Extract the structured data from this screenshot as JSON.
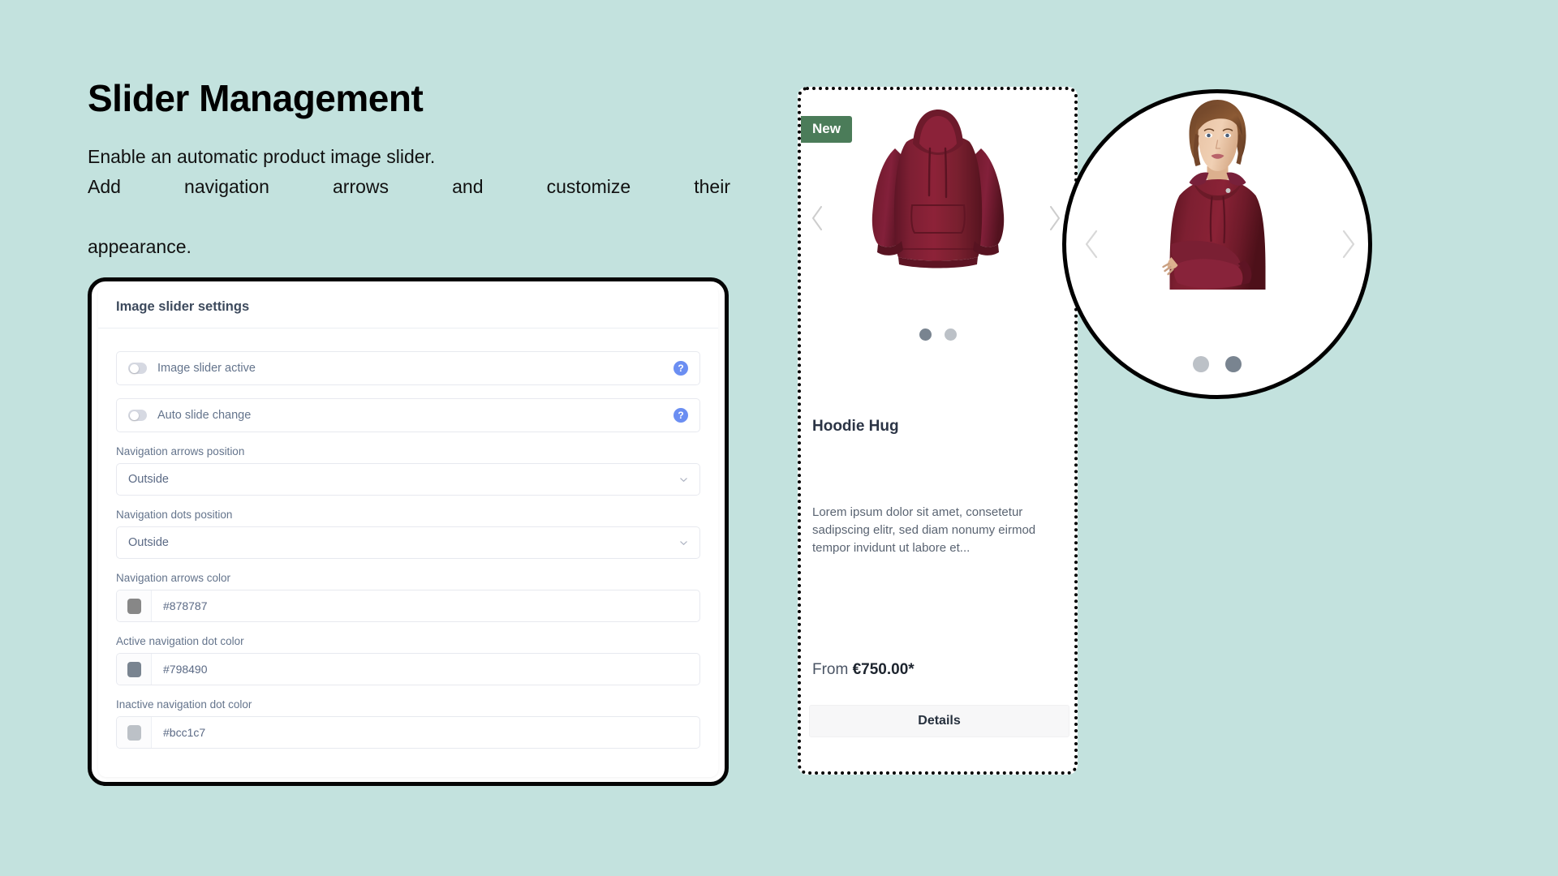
{
  "background_color": "#c3e2de",
  "heading": {
    "title": "Slider Management",
    "description_line1": "Enable an automatic product image slider.",
    "description_line2": "Add navigation arrows and customize their",
    "description_line3": "appearance."
  },
  "settings_card": {
    "header_title": "Image slider settings",
    "toggles": [
      {
        "label": "Image slider active",
        "state": "off",
        "help_icon": "help-icon",
        "help_glyph": "?"
      },
      {
        "label": "Auto slide change",
        "state": "off",
        "help_icon": "help-icon",
        "help_glyph": "?"
      }
    ],
    "selects": [
      {
        "label": "Navigation arrows position",
        "value": "Outside",
        "icon": "chevron-down-icon"
      },
      {
        "label": "Navigation dots position",
        "value": "Outside",
        "icon": "chevron-down-icon"
      }
    ],
    "colors": [
      {
        "label": "Navigation arrows color",
        "value": "#878787",
        "swatch": "#878787"
      },
      {
        "label": "Active navigation dot color",
        "value": "#798490",
        "swatch": "#798490"
      },
      {
        "label": "Inactive navigation dot color",
        "value": "#bcc1c7",
        "swatch": "#bcc1c7"
      }
    ]
  },
  "product_card": {
    "badge": "New",
    "badge_color": "#4b7c59",
    "title": "Hoodie Hug",
    "description": "Lorem ipsum dolor sit amet, consetetur sadipscing elitr, sed diam nonumy eirmod tempor invidunt ut labore et...",
    "price_prefix": "From",
    "price": "€750.00*",
    "details_button": "Details",
    "prev_arrow_icon": "chevron-left-icon",
    "next_arrow_icon": "chevron-right-icon",
    "dots": [
      {
        "state": "active",
        "color": "#798490"
      },
      {
        "state": "inactive",
        "color": "#bcc1c7"
      }
    ],
    "product_image_alt": "maroon hoodie product photo"
  },
  "magnifier": {
    "prev_arrow_icon": "chevron-left-icon",
    "next_arrow_icon": "chevron-right-icon",
    "dots": [
      {
        "state": "inactive",
        "color": "#bcc1c7"
      },
      {
        "state": "active",
        "color": "#798490"
      }
    ],
    "product_image_alt": "model wearing maroon hoodie"
  }
}
